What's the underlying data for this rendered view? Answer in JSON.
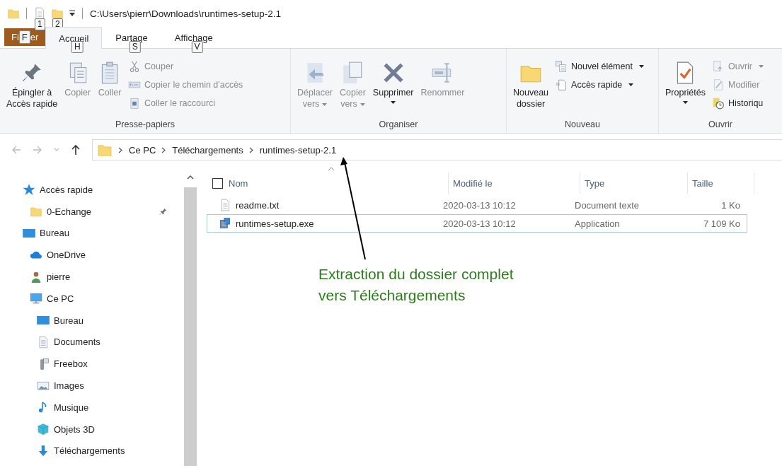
{
  "title_bar": {
    "keytips": [
      "1",
      "2"
    ],
    "path": "C:\\Users\\pierr\\Downloads\\runtimes-setup-2.1"
  },
  "ribbon_tabs": [
    {
      "kind": "file",
      "label_before": "Fi",
      "keytip": "F",
      "label_after": "er",
      "selected": false
    },
    {
      "kind": "tab",
      "label": "Accueil",
      "keytip": "H",
      "selected": true
    },
    {
      "kind": "tab",
      "label": "Partage",
      "keytip": "S",
      "selected": false
    },
    {
      "kind": "tab",
      "label": "Affichage",
      "keytip": "V",
      "selected": false
    }
  ],
  "ribbon_groups": [
    {
      "name": "Presse-papiers",
      "items": [
        {
          "kind": "large",
          "lines": [
            "Épingler à",
            "Accès rapide"
          ],
          "disabled": false,
          "dropdown": false
        },
        {
          "kind": "large",
          "lines": [
            "Copier"
          ],
          "disabled": true,
          "dropdown": false
        },
        {
          "kind": "large",
          "lines": [
            "Coller"
          ],
          "disabled": true,
          "dropdown": false
        },
        {
          "kind": "small",
          "label": "Couper",
          "disabled": true,
          "dropdown": false
        },
        {
          "kind": "small",
          "label": "Copier le chemin d'accès",
          "disabled": true,
          "dropdown": false
        },
        {
          "kind": "small",
          "label": "Coller le raccourci",
          "disabled": true,
          "dropdown": false
        }
      ]
    },
    {
      "name": "Organiser",
      "items": [
        {
          "kind": "large",
          "lines": [
            "Déplacer",
            "vers"
          ],
          "disabled": true,
          "dropdown": true
        },
        {
          "kind": "large",
          "lines": [
            "Copier",
            "vers"
          ],
          "disabled": true,
          "dropdown": true
        },
        {
          "kind": "large",
          "lines": [
            "Supprimer"
          ],
          "disabled": false,
          "dropdown": true
        },
        {
          "kind": "large",
          "lines": [
            "Renommer"
          ],
          "disabled": true,
          "dropdown": false
        }
      ]
    },
    {
      "name": "Nouveau",
      "items": [
        {
          "kind": "large",
          "lines": [
            "Nouveau",
            "dossier"
          ],
          "disabled": false,
          "dropdown": false
        },
        {
          "kind": "small",
          "label": "Nouvel élément",
          "disabled": false,
          "dropdown": true
        },
        {
          "kind": "small",
          "label": "Accès rapide",
          "disabled": false,
          "dropdown": true
        }
      ]
    },
    {
      "name": "Ouvrir",
      "items": [
        {
          "kind": "large",
          "lines": [
            "Propriétés"
          ],
          "disabled": false,
          "dropdown": true
        },
        {
          "kind": "small",
          "label": "Ouvrir",
          "disabled": true,
          "dropdown": true
        },
        {
          "kind": "small",
          "label": "Modifier",
          "disabled": true,
          "dropdown": false
        },
        {
          "kind": "small",
          "label": "Historiqu",
          "disabled": false,
          "dropdown": false
        }
      ]
    }
  ],
  "navigation": {
    "back_disabled": true,
    "forward_disabled": true,
    "breadcrumbs": [
      "Ce PC",
      "Téléchargements",
      "runtimes-setup-2.1"
    ]
  },
  "sidebar": {
    "items": [
      {
        "label": "Accès rapide",
        "children": [
          {
            "label": "0-Echange",
            "pinned": true
          }
        ]
      },
      {
        "label": "Bureau",
        "children": [
          {
            "label": "OneDrive"
          },
          {
            "label": "pierre"
          },
          {
            "label": "Ce PC",
            "children": [
              {
                "label": "Bureau"
              },
              {
                "label": "Documents"
              },
              {
                "label": "Freebox"
              },
              {
                "label": "Images"
              },
              {
                "label": "Musique"
              },
              {
                "label": "Objets 3D"
              },
              {
                "label": "Téléchargements"
              }
            ]
          }
        ]
      }
    ]
  },
  "file_list": {
    "select_all_checked": false,
    "columns": [
      {
        "label": "Nom",
        "sorted": true
      },
      {
        "label": "Modifié le",
        "sorted": false
      },
      {
        "label": "Type",
        "sorted": false
      },
      {
        "label": "Taille",
        "sorted": false
      }
    ],
    "rows": [
      {
        "kind": "text",
        "name": "readme.txt",
        "modified": "2020-03-13 10:12",
        "type": "Document texte",
        "size": "1 Ko",
        "selected": false,
        "focused": false
      },
      {
        "kind": "exe",
        "name": "runtimes-setup.exe",
        "modified": "2020-03-13 10:12",
        "type": "Application",
        "size": "7 109 Ko",
        "selected": false,
        "focused": true
      }
    ]
  },
  "annotation": {
    "lines": [
      "Extraction du dossier complet",
      "vers Téléchargements"
    ]
  }
}
